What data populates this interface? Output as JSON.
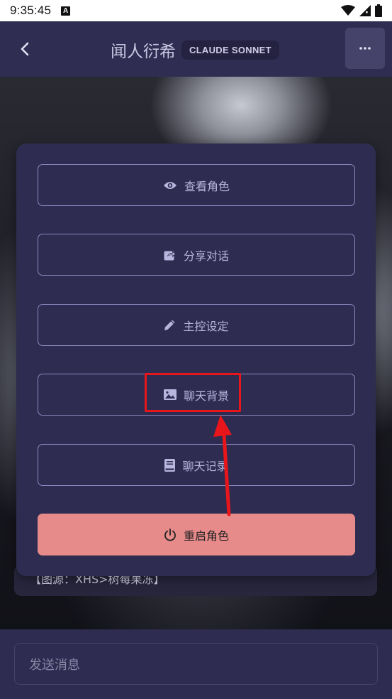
{
  "status_bar": {
    "time": "9:35:45",
    "indicator": "A",
    "icons": [
      "wifi-icon",
      "signal-icon",
      "battery-icon"
    ]
  },
  "header": {
    "back_icon": "chevron-left-icon",
    "title": "闻人衍希",
    "model_badge": "CLAUDE SONNET",
    "more_icon": "more-horizontal-icon"
  },
  "background_caption": "【图源：XHS>树莓果冻】",
  "menu": {
    "items": [
      {
        "label": "查看角色",
        "icon": "eye-icon"
      },
      {
        "label": "分享对话",
        "icon": "share-icon"
      },
      {
        "label": "主控设定",
        "icon": "pencil-icon"
      },
      {
        "label": "聊天背景",
        "icon": "image-icon"
      },
      {
        "label": "聊天记录",
        "icon": "book-icon"
      }
    ],
    "restart": {
      "label": "重启角色",
      "icon": "power-icon"
    }
  },
  "input": {
    "placeholder": "发送消息"
  },
  "colors": {
    "header_bg": "#2f2d52",
    "menu_bg": "#2e2c50",
    "menu_border": "#8d88c0",
    "menu_text": "#b9b5df",
    "restart_bg": "#e68a8a",
    "annotation": "#e8161a"
  }
}
